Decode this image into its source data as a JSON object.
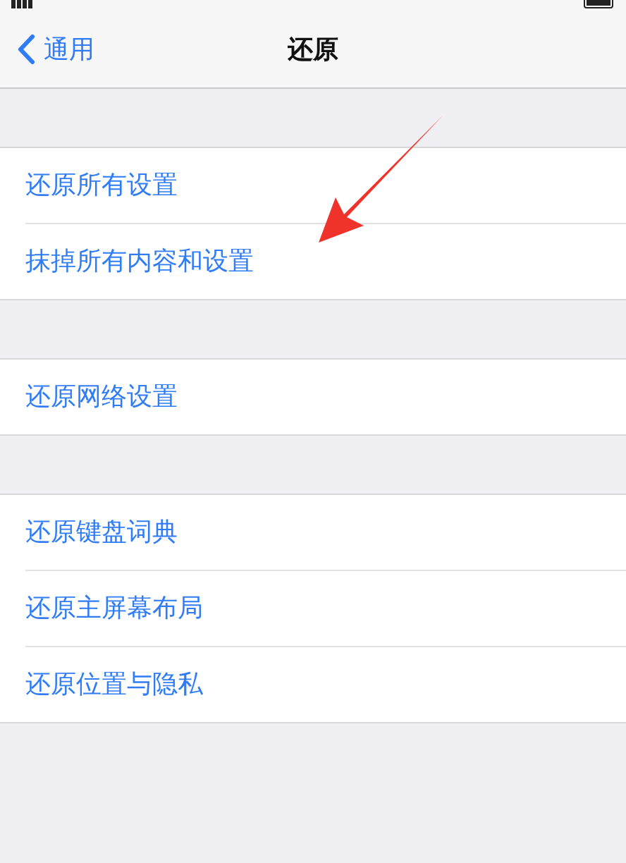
{
  "nav": {
    "back": "通用",
    "title": "还原"
  },
  "groups": [
    {
      "items": [
        "还原所有设置",
        "抹掉所有内容和设置"
      ]
    },
    {
      "items": [
        "还原网络设置"
      ]
    },
    {
      "items": [
        "还原键盘词典",
        "还原主屏幕布局",
        "还原位置与隐私"
      ]
    }
  ]
}
